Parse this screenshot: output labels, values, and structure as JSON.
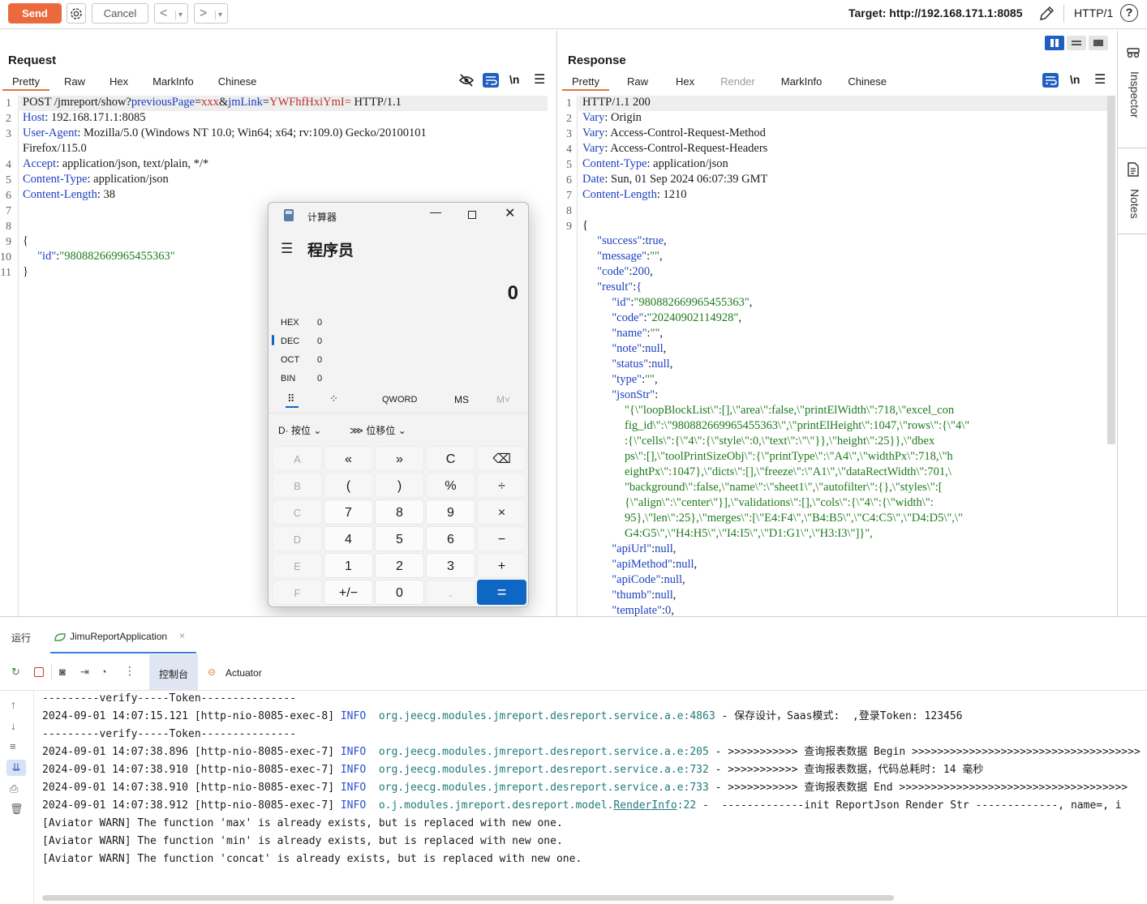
{
  "toolbar": {
    "send": "Send",
    "cancel": "Cancel",
    "back": "<",
    "forward": ">",
    "dropdown": "▾",
    "target": "Target: http://192.168.171.1:8085",
    "http": "HTTP/1",
    "help": "?"
  },
  "request": {
    "title": "Request",
    "tabs": [
      "Pretty",
      "Raw",
      "Hex",
      "MarkInfo",
      "Chinese"
    ],
    "newline_label": "\\n",
    "line_numbers": [
      "1",
      "2",
      "3",
      "",
      "4",
      "5",
      "6",
      "7",
      "8",
      "9",
      "10",
      "11"
    ],
    "lines": {
      "l1_method": "POST /jmreport/show?",
      "l1_param1": "previousPage",
      "l1_eq1": "=",
      "l1_val1": "xxx",
      "l1_amp": "&",
      "l1_param2": "jmLink",
      "l1_eq2": "=",
      "l1_val2": "YWFhfHxiYmI=",
      "l1_proto": " HTTP/1.1",
      "l2_key": "Host",
      "l2_val": ": 192.168.171.1:8085",
      "l3_key": "User-Agent",
      "l3_val": ": Mozilla/5.0 (Windows NT 10.0; Win64; x64; rv:109.0) Gecko/20100101",
      "l3_cont": "Firefox/115.0",
      "l4_key": "Accept",
      "l4_val": ": application/json, text/plain, */*",
      "l5_key": "Content-Type",
      "l5_val": ": application/json",
      "l6_key": "Content-Length",
      "l6_val": ": 38",
      "l9": "{",
      "l10_key": "\"id\"",
      "l10_colon": ":",
      "l10_val": "\"980882669965455363\"",
      "l11": "}"
    }
  },
  "response": {
    "title": "Response",
    "tabs": [
      "Pretty",
      "Raw",
      "Hex",
      "Render",
      "MarkInfo",
      "Chinese"
    ],
    "newline_label": "\\n",
    "line_numbers": [
      "1",
      "2",
      "3",
      "4",
      "5",
      "6",
      "7",
      "8",
      "9"
    ],
    "headers": [
      {
        "key": "HTTP/1.1 200",
        "val": ""
      },
      {
        "key": "Vary",
        "val": ": Origin"
      },
      {
        "key": "Vary",
        "val": ": Access-Control-Request-Method"
      },
      {
        "key": "Vary",
        "val": ": Access-Control-Request-Headers"
      },
      {
        "key": "Content-Type",
        "val": ": application/json"
      },
      {
        "key": "Date",
        "val": ": Sun, 01 Sep 2024 06:07:39 GMT"
      },
      {
        "key": "Content-Length",
        "val": ": 1210"
      }
    ],
    "body_open": "{",
    "body": [
      {
        "indent": 1,
        "key": "\"success\"",
        "val": "true",
        "type": "n",
        "tail": ","
      },
      {
        "indent": 1,
        "key": "\"message\"",
        "val": "\"\"",
        "type": "s",
        "tail": ","
      },
      {
        "indent": 1,
        "key": "\"code\"",
        "val": "200",
        "type": "n",
        "tail": ","
      },
      {
        "indent": 1,
        "key": "\"result\"",
        "val": "{",
        "type": "n",
        "tail": ""
      },
      {
        "indent": 2,
        "key": "\"id\"",
        "val": "\"980882669965455363\"",
        "type": "s",
        "tail": ","
      },
      {
        "indent": 2,
        "key": "\"code\"",
        "val": "\"20240902114928\"",
        "type": "s",
        "tail": ","
      },
      {
        "indent": 2,
        "key": "\"name\"",
        "val": "\"\"",
        "type": "s",
        "tail": ","
      },
      {
        "indent": 2,
        "key": "\"note\"",
        "val": "null",
        "type": "n",
        "tail": ","
      },
      {
        "indent": 2,
        "key": "\"status\"",
        "val": "null",
        "type": "n",
        "tail": ","
      },
      {
        "indent": 2,
        "key": "\"type\"",
        "val": "\"\"",
        "type": "s",
        "tail": ","
      },
      {
        "indent": 2,
        "key": "\"jsonStr\"",
        "val": "",
        "type": "n",
        "tail": ""
      }
    ],
    "jsonstr_lines": [
      "\"{\\\"loopBlockList\\\":[],\\\"area\\\":false,\\\"printElWidth\\\":718,\\\"excel_con",
      "fig_id\\\":\\\"980882669965455363\\\",\\\"printElHeight\\\":1047,\\\"rows\\\":{\\\"4\\\"",
      ":{\\\"cells\\\":{\\\"4\\\":{\\\"style\\\":0,\\\"text\\\":\\\"\\\"}},\\\"height\\\":25}},\\\"dbex",
      "ps\\\":[],\\\"toolPrintSizeObj\\\":{\\\"printType\\\":\\\"A4\\\",\\\"widthPx\\\":718,\\\"h",
      "eightPx\\\":1047},\\\"dicts\\\":[],\\\"freeze\\\":\\\"A1\\\",\\\"dataRectWidth\\\":701,\\",
      "\"background\\\":false,\\\"name\\\":\\\"sheet1\\\",\\\"autofilter\\\":{},\\\"styles\\\":[",
      "{\\\"align\\\":\\\"center\\\"}],\\\"validations\\\":[],\\\"cols\\\":{\\\"4\\\":{\\\"width\\\":",
      "95},\\\"len\\\":25},\\\"merges\\\":[\\\"E4:F4\\\",\\\"B4:B5\\\",\\\"C4:C5\\\",\\\"D4:D5\\\",\\\"",
      "G4:G5\\\",\\\"H4:H5\\\",\\\"I4:I5\\\",\\\"D1:G1\\\",\\\"H3:I3\\\"]}\","
    ],
    "tail": [
      {
        "key": "\"apiUrl\"",
        "val": "null"
      },
      {
        "key": "\"apiMethod\"",
        "val": "null"
      },
      {
        "key": "\"apiCode\"",
        "val": "null"
      },
      {
        "key": "\"thumb\"",
        "val": "null"
      },
      {
        "key": "\"template\"",
        "val": "0"
      }
    ]
  },
  "sidebar": {
    "inspector": "Inspector",
    "notes": "Notes"
  },
  "calculator": {
    "window_title": "计算器",
    "mode": "程序员",
    "display": "0",
    "bases": [
      {
        "name": "HEX",
        "value": "0"
      },
      {
        "name": "DEC",
        "value": "0"
      },
      {
        "name": "OCT",
        "value": "0"
      },
      {
        "name": "BIN",
        "value": "0"
      }
    ],
    "word_size": "QWORD",
    "ms": "MS",
    "mr": "M˅",
    "bitwise": "按位",
    "bitshift": "位移位",
    "keys": [
      [
        "A",
        "«",
        "»",
        "C",
        "⌫"
      ],
      [
        "B",
        "(",
        ")",
        "%",
        "÷"
      ],
      [
        "C",
        "7",
        "8",
        "9",
        "×"
      ],
      [
        "D",
        "4",
        "5",
        "6",
        "−"
      ],
      [
        "E",
        "1",
        "2",
        "3",
        "+"
      ],
      [
        "F",
        "+/−",
        "0",
        ".",
        "="
      ]
    ]
  },
  "run": {
    "tab_run": "运行",
    "app_tab": "JimuReportApplication",
    "console_tab": "控制台",
    "actuator_tab": "Actuator",
    "logs": [
      {
        "plain": "---------verify-----Token---------------"
      },
      {
        "time": "2024-09-01 14:07:15.121 [http-nio-8085-exec-8] ",
        "level": "INFO",
        "cls": "org.jeecg.modules.jmreport.desreport.service.a.e:4863",
        "msg": " - 保存设计，Saas模式:  ,登录Token: 123456"
      },
      {
        "plain": "---------verify-----Token---------------"
      },
      {
        "time": "2024-09-01 14:07:38.896 [http-nio-8085-exec-7] ",
        "level": "INFO",
        "cls": "org.jeecg.modules.jmreport.desreport.service.a.e:205",
        "msg": " - >>>>>>>>>>> 查询报表数据 Begin >>>>>>>>>>>>>>>>>>>>>>>>>>>>>>>>>>>>"
      },
      {
        "time": "2024-09-01 14:07:38.910 [http-nio-8085-exec-7] ",
        "level": "INFO",
        "cls": "org.jeecg.modules.jmreport.desreport.service.a.e:732",
        "msg": " - >>>>>>>>>>> 查询报表数据，代码总耗时: 14 毫秒"
      },
      {
        "time": "2024-09-01 14:07:38.910 [http-nio-8085-exec-7] ",
        "level": "INFO",
        "cls": "org.jeecg.modules.jmreport.desreport.service.a.e:733",
        "msg": " - >>>>>>>>>>> 查询报表数据 End >>>>>>>>>>>>>>>>>>>>>>>>>>>>>>>>>>>>"
      },
      {
        "time": "2024-09-01 14:07:38.912 [http-nio-8085-exec-7] ",
        "level": "INFO",
        "cls_pre": "o.j.modules.jmreport.desreport.model.",
        "cls_link": "RenderInfo",
        "cls_post": ":22",
        "msg": " -  -------------init ReportJson Render Str -------------, name=, i"
      },
      {
        "plain": "[Aviator WARN] The function 'max' is already exists, but is replaced with new one."
      },
      {
        "plain": "[Aviator WARN] The function 'min' is already exists, but is replaced with new one."
      },
      {
        "plain": "[Aviator WARN] The function 'concat' is already exists, but is replaced with new one."
      }
    ]
  }
}
